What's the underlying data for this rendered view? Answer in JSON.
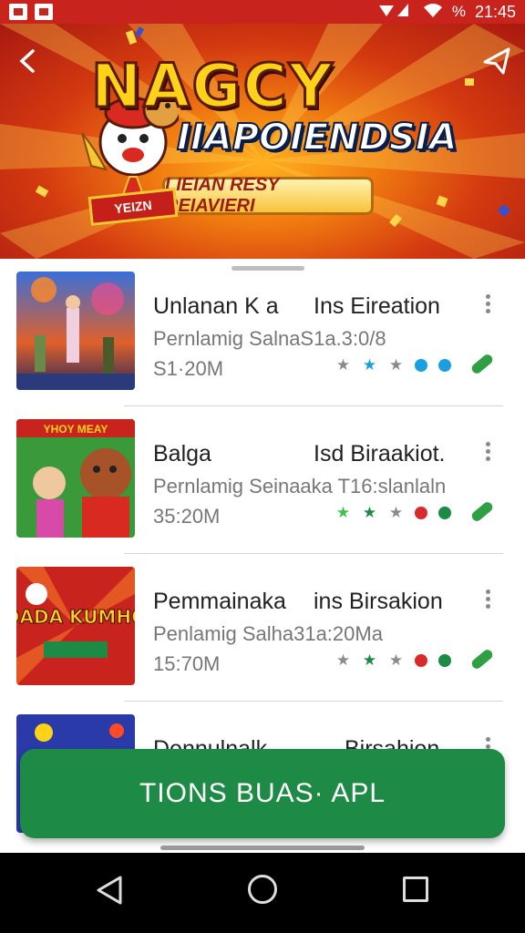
{
  "status_bar": {
    "time": "21:45",
    "battery": "%"
  },
  "banner": {
    "logo_line1": "NAGCY",
    "logo_line2": "IIAPOIENDSIA",
    "tagline": "LIEIAN RESY REIAVIERI",
    "badge": "YEIZN"
  },
  "apps": [
    {
      "title": "Unlanan K a",
      "title_right": "Ins Eireation",
      "subtitle": "Pernlamig SalnaS1a.3:0/8",
      "size": "S1·20M",
      "rating_dots": [
        "#8a8a8a",
        "#1aa0e0",
        "#8a8a8a",
        "#1aa0e0",
        "#1aa0e0"
      ],
      "thumb_label": ""
    },
    {
      "title": "Balga",
      "title_right": "Isd Biraakiot.",
      "subtitle": "Pernlamig Seinaaka T16:slanlaln",
      "size": "35:20M",
      "rating_dots": [
        "#3cc04a",
        "#1a8a45",
        "#8a8a8a",
        "#d92a2a",
        "#1a8a45"
      ],
      "thumb_label": "YHOY MEAY"
    },
    {
      "title": "Pemmainaka",
      "title_right": "ins Birsakion",
      "subtitle": "Penlamig Salha31a:20Ma",
      "size": "15:70M",
      "rating_dots": [
        "#8a8a8a",
        "#1a8a45",
        "#8a8a8a",
        "#d92a2a",
        "#1a8a45"
      ],
      "thumb_label": "DADA KUMHO"
    },
    {
      "title": "Dennulnalk",
      "title_right": "Birsahion",
      "subtitle": "",
      "size": "",
      "rating_dots": [],
      "thumb_label": ""
    }
  ],
  "install_button": {
    "label": "TIONS BUAS· APL"
  },
  "colors": {
    "accent_green": "#1d8a45",
    "banner_red": "#c8231d"
  }
}
